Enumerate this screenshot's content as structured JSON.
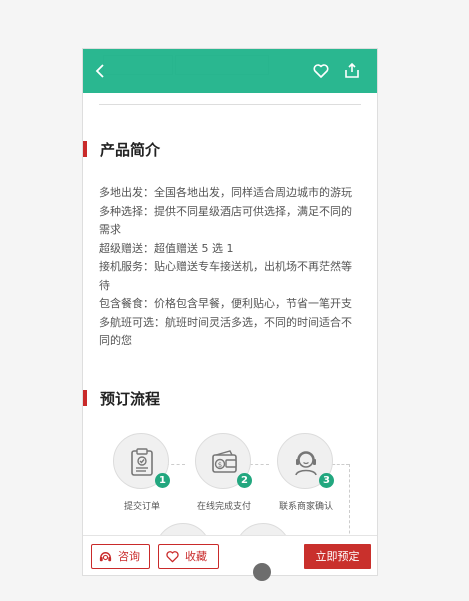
{
  "header": {
    "back_icon": "chevron-left-icon",
    "favorite_icon": "heart-icon",
    "share_icon": "share-icon",
    "accent": "#1ab288"
  },
  "sections": {
    "intro_title": "产品简介",
    "process_title": "预订流程"
  },
  "intro": {
    "lines": [
      "多地出发：全国各地出发，同样适合周边城市的游玩",
      "多种选择：提供不同星级酒店可供选择，满足不同的需求",
      "超级赠送：超值赠送 5 选 1",
      "接机服务：贴心赠送专车接送机，出机场不再茫然等待",
      "包含餐食：价格包含早餐，便利贴心，节省一笔开支",
      "多航班可选：航班时间灵活多选，不同的时间适合不同的您"
    ]
  },
  "process": {
    "steps": [
      {
        "num": "1",
        "label": "提交订单",
        "icon": "clipboard-check-icon"
      },
      {
        "num": "2",
        "label": "在线完成支付",
        "icon": "wallet-icon"
      },
      {
        "num": "3",
        "label": "联系商家确认",
        "icon": "customer-service-icon"
      }
    ]
  },
  "bottom_bar": {
    "consult_label": "咨询",
    "favorite_label": "收藏",
    "book_label": "立即预定",
    "primary_color": "#c9302c"
  }
}
